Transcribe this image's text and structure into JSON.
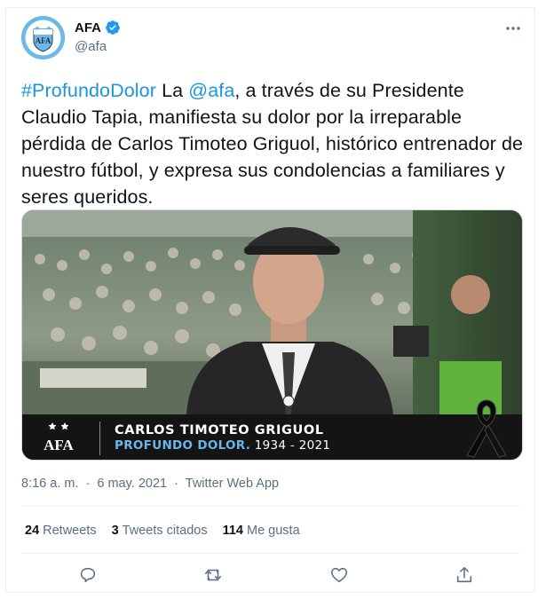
{
  "author": {
    "display_name": "AFA",
    "handle": "@afa",
    "avatar_icon": "afa-crest-icon",
    "verified_icon": "verified-badge-icon"
  },
  "tweet": {
    "hashtag": "#ProfundoDolor",
    "t1": " La ",
    "mention": "@afa",
    "t2": ", a través de su Presidente Claudio Tapia, manifiesta su dolor por la irreparable pérdida de Carlos Timoteo Griguol, histórico entrenador de nuestro fútbol, y expresa sus condolencias a familiares y seres queridos."
  },
  "media": {
    "banner_logo": "AFA",
    "banner_name": "CARLOS TIMOTEO GRIGUOL",
    "banner_highlight": "PROFUNDO DOLOR.",
    "banner_years": " 1934 - 2021",
    "ribbon_icon": "mourning-ribbon-icon"
  },
  "meta": {
    "time": "8:16 a. m.",
    "dot": "·",
    "date": "6 may. 2021",
    "dot2": "·",
    "source": "Twitter Web App"
  },
  "stats": {
    "retweets_count": "24",
    "retweets_label": "Retweets",
    "quotes_count": "3",
    "quotes_label": "Tweets citados",
    "likes_count": "114",
    "likes_label": "Me gusta"
  },
  "colors": {
    "link": "#1b95e0",
    "secondary_text": "#5b7083",
    "banner_highlight": "#67b8e9"
  }
}
